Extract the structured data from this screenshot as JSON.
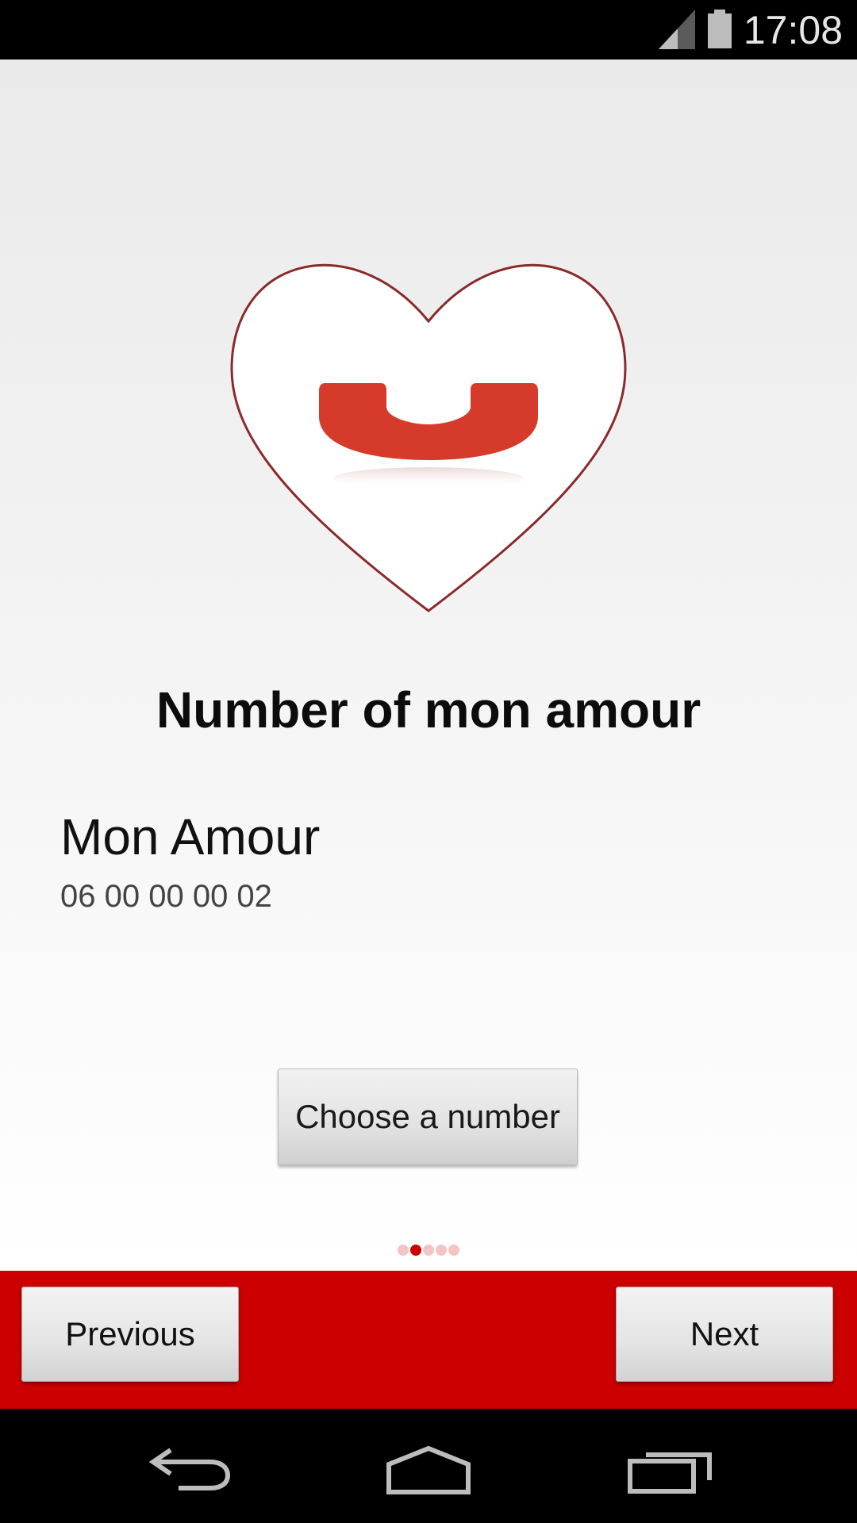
{
  "status_bar": {
    "time": "17:08",
    "signal_icon": "signal-icon",
    "battery_icon": "battery-icon"
  },
  "main": {
    "logo_icon": "heart-phone-icon",
    "title": "Number of mon amour",
    "contact": {
      "name": "Mon Amour",
      "number": "06 00 00 00 02"
    },
    "choose_button_label": "Choose a number",
    "pager": {
      "total": 5,
      "active_index": 1
    }
  },
  "bottom_bar": {
    "previous_label": "Previous",
    "next_label": "Next"
  },
  "nav_bar": {
    "back_icon": "back-icon",
    "home_icon": "home-icon",
    "recents_icon": "recents-icon"
  },
  "colors": {
    "accent": "#cc0000",
    "phone_red": "#d63a2a"
  }
}
